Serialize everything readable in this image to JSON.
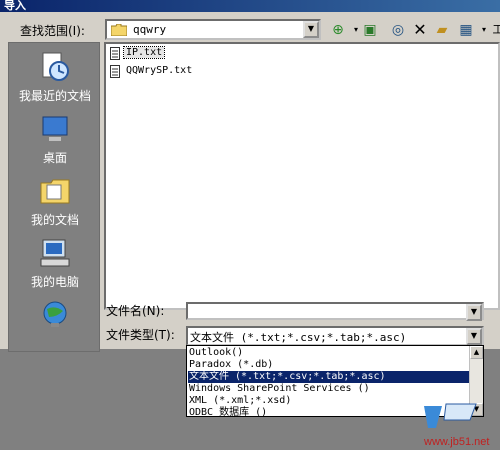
{
  "window": {
    "title": "导入"
  },
  "lookin": {
    "label": "查找范围(I):",
    "value": "qqwry"
  },
  "places": [
    {
      "label": "我最近的文档",
      "icon": "recent-documents-icon"
    },
    {
      "label": "桌面",
      "icon": "desktop-icon"
    },
    {
      "label": "我的文档",
      "icon": "my-documents-icon"
    },
    {
      "label": "我的电脑",
      "icon": "my-computer-icon"
    },
    {
      "label": "",
      "icon": "network-places-icon"
    }
  ],
  "files": [
    {
      "name": "IP.txt",
      "selected": true
    },
    {
      "name": "QQWrySP.txt",
      "selected": false
    }
  ],
  "filename": {
    "label": "文件名(N):",
    "value": ""
  },
  "filetype": {
    "label": "文件类型(T):",
    "value": "文本文件 (*.txt;*.csv;*.tab;*.asc)",
    "options": [
      "Outlook()",
      "Paradox (*.db)",
      "文本文件 (*.txt;*.csv;*.tab;*.asc)",
      "Windows SharePoint Services ()",
      "XML (*.xml;*.xsd)",
      "ODBC 数据库 ()"
    ],
    "selected_index": 2
  },
  "watermark": {
    "site": "www.jb51.net"
  },
  "colors": {
    "titlebar": "#0a246a",
    "selection": "#0a246a",
    "dialog": "#d4d0c8"
  }
}
